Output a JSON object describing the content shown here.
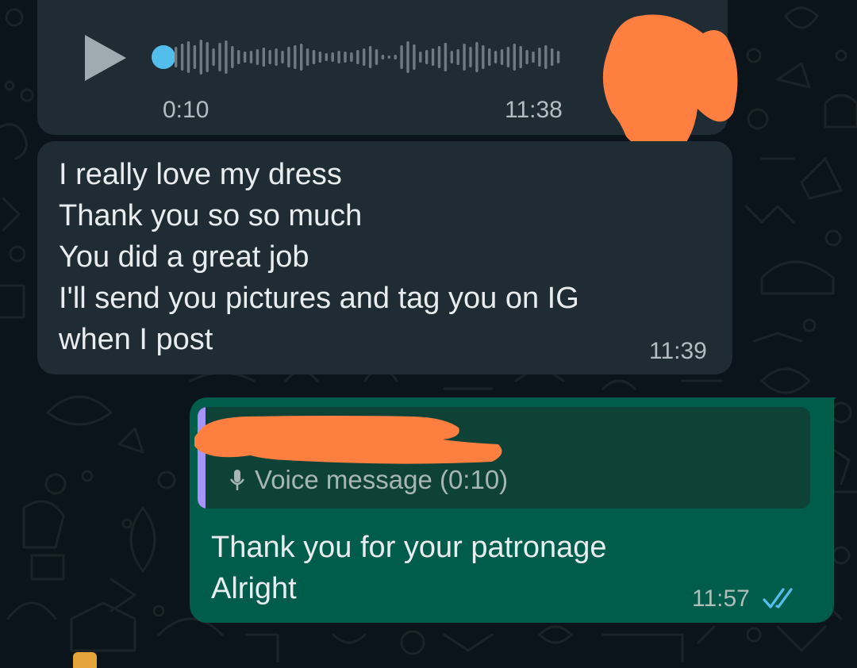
{
  "colors": {
    "background": "#0b141a",
    "incoming_bubble": "#202c33",
    "outgoing_bubble": "#005c4b",
    "quote_bar": "#a594f9",
    "seek_dot": "#53bdeb",
    "read_ticks": "#53bdeb",
    "redaction": "#ff7f41"
  },
  "voice_message": {
    "duration": "0:10",
    "time": "11:38",
    "icon": "play-icon"
  },
  "incoming_text": {
    "lines": [
      "I really love my dress",
      "Thank you so so much",
      "You did a great job",
      "I'll send you pictures and tag you on IG",
      "when I post"
    ],
    "time": "11:39"
  },
  "outgoing_reply": {
    "quoted": {
      "icon": "mic-icon",
      "label": "Voice message (0:10)"
    },
    "lines": [
      "Thank you for your patronage",
      "Alright"
    ],
    "time": "11:57",
    "status_icon": "double-check-icon"
  }
}
